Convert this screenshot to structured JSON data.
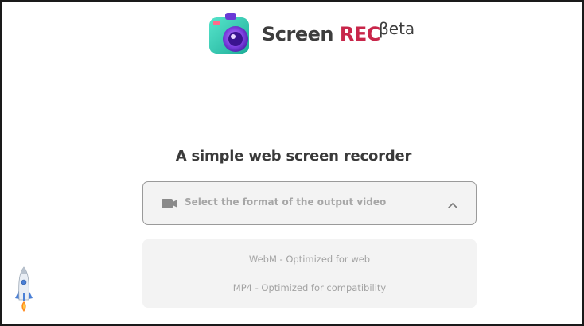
{
  "app": {
    "brand_part1": "Screen ",
    "brand_part2": "REC",
    "beta_label": "βeta",
    "brand_color": "#3d3d3d",
    "accent_color": "#c8264a"
  },
  "main": {
    "subtitle": "A simple web screen recorder"
  },
  "format_select": {
    "placeholder": "Select the format of the output video",
    "icon": "video-camera-icon",
    "state_icon": "chevron-up-icon",
    "options": [
      {
        "label": "WebM - Optimized for web"
      },
      {
        "label": "MP4 - Optimized for compatibility"
      }
    ]
  },
  "icons": {
    "logo": "camera-logo-icon",
    "rocket": "rocket-icon"
  }
}
